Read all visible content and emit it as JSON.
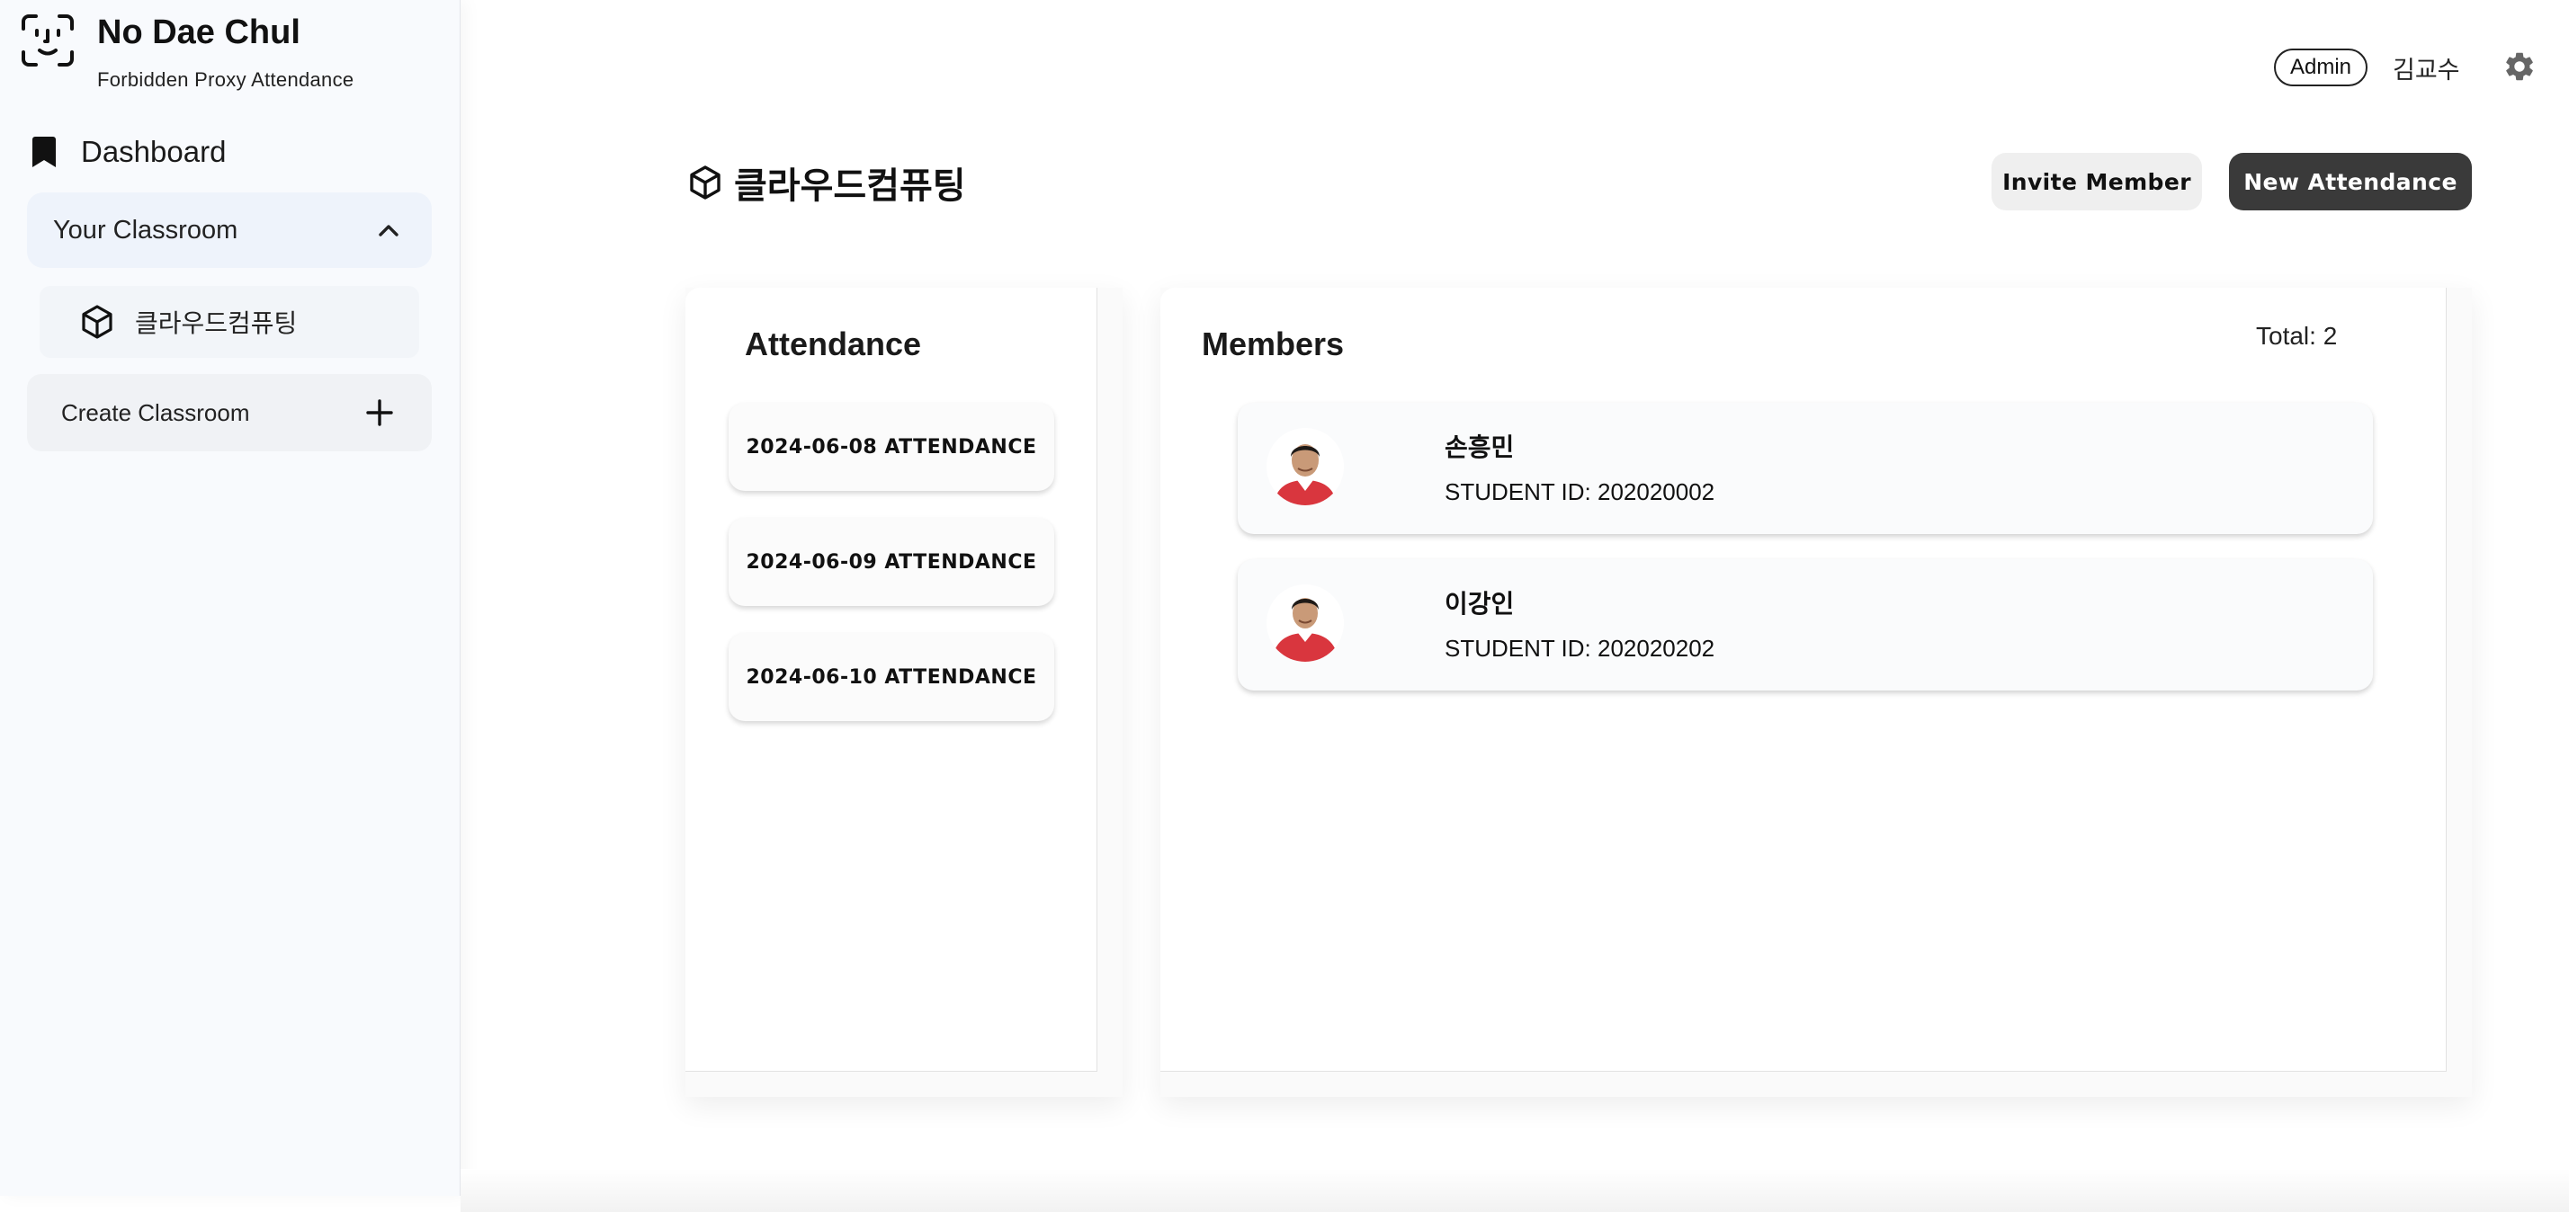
{
  "brand": {
    "title": "No Dae Chul",
    "subtitle": "Forbidden Proxy Attendance",
    "icon": "face-id-icon"
  },
  "sidebar": {
    "dashboard_label": "Dashboard",
    "classroom_section_label": "Your Classroom",
    "classrooms": [
      {
        "label": "클라우드컴퓨팅",
        "icon": "cube-icon"
      }
    ],
    "create_label": "Create Classroom"
  },
  "topbar": {
    "role_badge": "Admin",
    "user_name": "김교수",
    "settings_icon": "gear-icon"
  },
  "header": {
    "title": "클라우드컴퓨팅",
    "invite_label": "Invite Member",
    "new_attendance_label": "New Attendance"
  },
  "attendance": {
    "title": "Attendance",
    "items": [
      "2024-06-08 ATTENDANCE",
      "2024-06-09 ATTENDANCE",
      "2024-06-10 ATTENDANCE"
    ]
  },
  "members": {
    "title": "Members",
    "total": "Total: 2",
    "list": [
      {
        "name": "손흥민",
        "student_id": "STUDENT ID: 202020002"
      },
      {
        "name": "이강인",
        "student_id": "STUDENT ID: 202020202"
      }
    ]
  },
  "colors": {
    "primary_button": "#3a3a3a",
    "secondary_button": "#efefef",
    "sidebar_bg": "#f8fafd",
    "jersey_red": "#d9363e"
  }
}
